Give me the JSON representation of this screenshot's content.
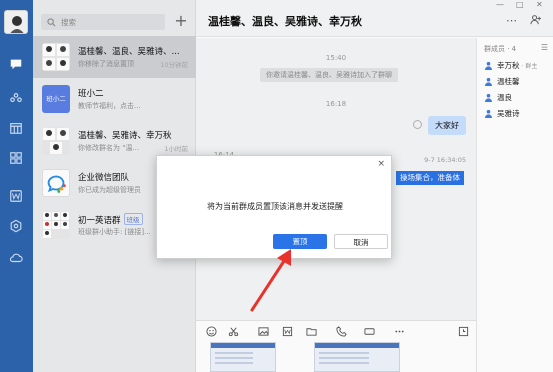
{
  "search": {
    "placeholder": "搜索"
  },
  "conversations": [
    {
      "name": "温桂馨、温良、吴雅诗、...",
      "sub": "你移除了消息置顶",
      "time": "10分钟前"
    },
    {
      "name": "班小二",
      "sub": "教师节福利，点击...",
      "time": "",
      "thumb_text": "班小二"
    },
    {
      "name": "温桂馨、吴雅诗、幸万秋",
      "sub": "你修改群名为 \"温...",
      "time": "1小时前"
    },
    {
      "name": "企业微信团队",
      "sub": "你已成为超级管理员",
      "time": ""
    },
    {
      "name": "初一英语群",
      "tag": "班级",
      "sub": "班级群小助手: [链接]...",
      "time": ""
    }
  ],
  "header": {
    "title": "温桂馨、温良、吴雅诗、幸万秋"
  },
  "chat": {
    "ts1": "15:40",
    "system": "你邀请温桂馨、温良、吴雅诗加入了群聊",
    "ts2": "16:18",
    "bubble": "大家好",
    "ts3": "16:14",
    "ts_right": "9-7 16:34:05",
    "highlight": "操场集合，准备体"
  },
  "members": {
    "header": "群成员 · 4",
    "list": [
      {
        "name": "幸万秋",
        "owner": "· 群主"
      },
      {
        "name": "温桂馨",
        "owner": ""
      },
      {
        "name": "温良",
        "owner": ""
      },
      {
        "name": "吴雅诗",
        "owner": ""
      }
    ]
  },
  "dialog": {
    "close": "×",
    "message": "将为当前群成员置顶该消息并发送提醒",
    "confirm": "置顶",
    "cancel": "取消"
  },
  "colors": {
    "rail": "#2d64ad",
    "accent": "#2a74e7",
    "arrow": "#e8322b"
  }
}
